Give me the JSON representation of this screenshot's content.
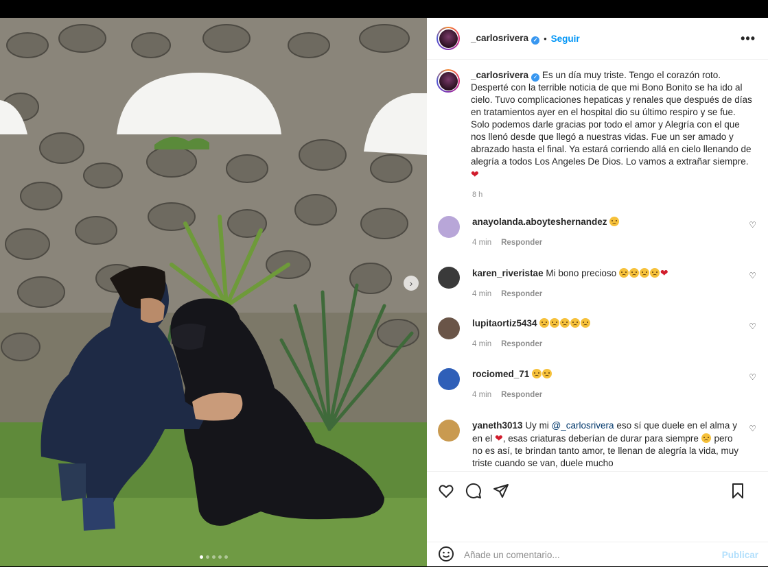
{
  "post": {
    "username": "_carlosrivera",
    "follow_label": "Seguir",
    "bullet": "•",
    "more_label": "•••",
    "verified_mark": "✓",
    "caption": "Es un día muy triste. Tengo el corazón roto. Desperté con la terrible noticia de que mi Bono Bonito se ha ido al cielo. Tuvo complicaciones hepaticas y renales que después de días en tratamientos ayer en el hospital dio su último respiro y se fue. Solo podemos darle gracias por todo el amor y Alegría con el que nos llenó desde que llegó a nuestras vidas. Fue un ser amado y abrazado hasta el final. Ya estará corriendo allá en cielo llenando de alegría a todos Los Angeles De Dios. Lo vamos a extrañar siempre.",
    "caption_time": "8 h",
    "next_arrow": "›",
    "carousel_dots": 5
  },
  "comments": [
    {
      "user": "anayolanda.aboyteshernandez",
      "text": "",
      "emojis": 1,
      "hearts": 0,
      "time": "4 min",
      "reply": "Responder",
      "avatar_color": "#b8a6d8"
    },
    {
      "user": "karen_riveristae",
      "text": "Mi bono precioso",
      "emojis": 4,
      "hearts": 1,
      "time": "4 min",
      "reply": "Responder",
      "avatar_color": "#3a3a3a"
    },
    {
      "user": "lupitaortiz5434",
      "text": "",
      "emojis": 5,
      "hearts": 0,
      "time": "4 min",
      "reply": "Responder",
      "avatar_color": "#6a5548"
    },
    {
      "user": "rociomed_71",
      "text": "",
      "emojis": 2,
      "hearts": 0,
      "time": "4 min",
      "reply": "Responder",
      "avatar_color": "#2f5fb8"
    },
    {
      "user": "yaneth3013",
      "text_before": "Uy mi",
      "mention": "@_carlosrivera",
      "text_mid": "eso sí que duele en el alma y en el",
      "text_mid2": ", esas criaturas deberían de durar para siempre",
      "text_after": "pero no es así, te brindan tanto amor, te llenan de alegría la vida, muy triste cuando se van, duele mucho",
      "avatar_color": "#c99a50"
    }
  ],
  "comment_box": {
    "placeholder": "Añade un comentario...",
    "publish_label": "Publicar"
  },
  "icons": [
    "heart-icon",
    "comment-icon",
    "share-icon",
    "bookmark-icon",
    "emoji-icon",
    "more-icon",
    "verified-icon",
    "next-arrow-icon"
  ]
}
